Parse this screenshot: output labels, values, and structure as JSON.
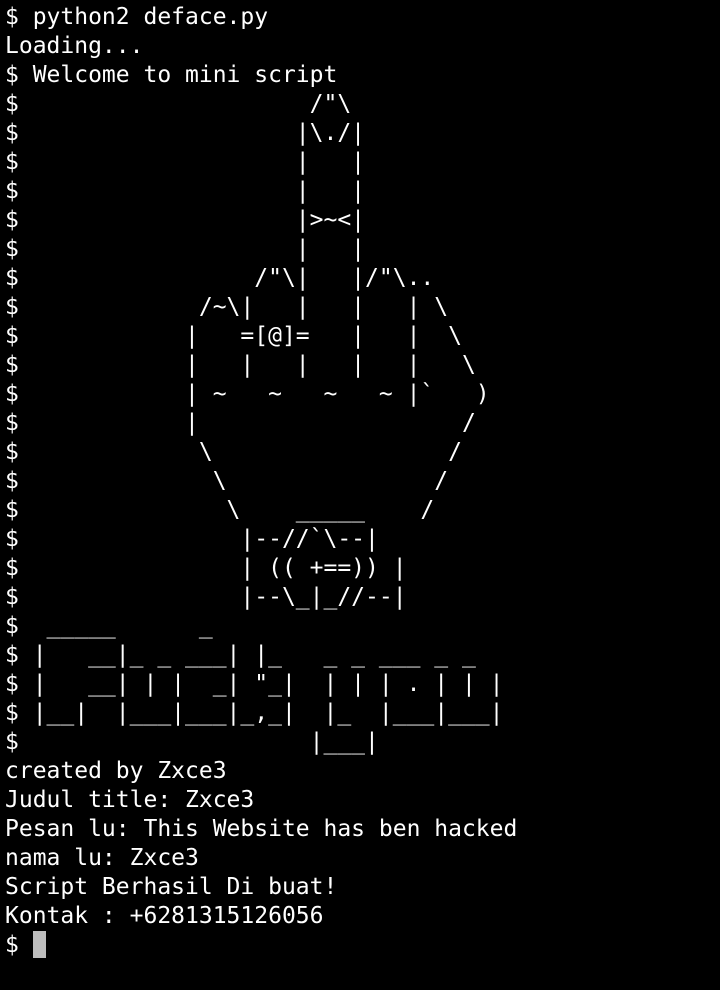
{
  "terminal": {
    "background": "#000000",
    "foreground": "#ffffff",
    "cursor_color": "#bdbdbd",
    "lines": [
      "$ python2 deface.py",
      "Loading...",
      "$ Welcome to mini script",
      "$                     /\"\\",
      "$                    |\\./|",
      "$                    |   |",
      "$                    |   |",
      "$                    |>~<|",
      "$                    |   |",
      "$                 /\"\\|   |/\"\\..",
      "$             /~\\|   |   |   | \\",
      "$            |   =[@]=   |   |  \\",
      "$            |   |   |   |   |   \\",
      "$            | ~   ~   ~   ~ |`   )",
      "$            |                   /",
      "$             \\                 /",
      "$              \\               /",
      "$               \\    _____    /",
      "$                |--//`\\--|",
      "$                | (( +==)) |",
      "$                |--\\_|_//--|",
      "$  _____      _",
      "$ |   __|_ _ ___| |_   _ _ ___ _ _",
      "$ |   __| | |  _| \"_|  | | | . | | |",
      "$ |__|  |___|___|_,_|  |_  |___|___|",
      "$                     |___|",
      "created by Zxce3",
      "Judul title: Zxce3",
      "Pesan lu: This Website has ben hacked",
      "nama lu: Zxce3",
      "Script Berhasil Di buat!",
      "Kontak : +6281315126056"
    ],
    "prompt": "$ "
  }
}
